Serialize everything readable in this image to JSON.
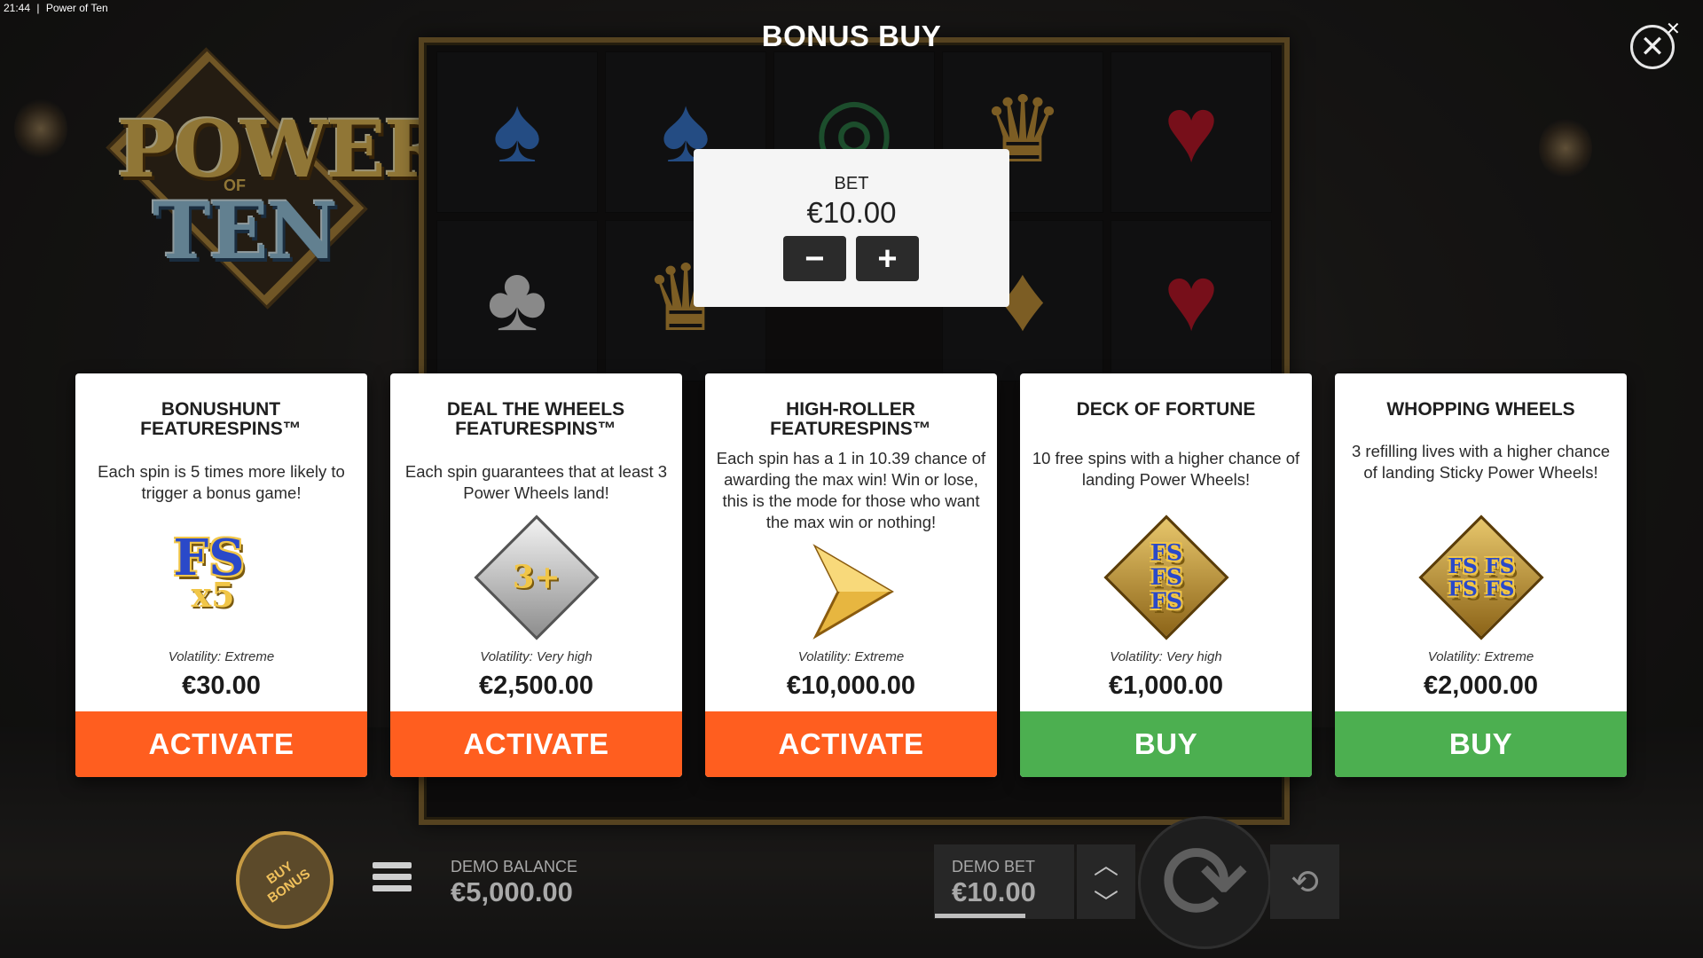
{
  "status_bar": {
    "time": "21:44",
    "app": "Power of Ten"
  },
  "title": "BONUS BUY",
  "close_icon": "close-icon",
  "logo": {
    "line1": "POWER",
    "line2": "OF",
    "line3": "TEN"
  },
  "bet": {
    "label": "BET",
    "value": "€10.00",
    "minus": "−",
    "plus": "+"
  },
  "cards": [
    {
      "title": "BONUSHUNT FEATURESPINS™",
      "description": "Each spin is 5 times more likely to trigger a bonus game!",
      "icon": "fs-x5-icon",
      "icon_text": "FS",
      "icon_sub": "x5",
      "volatility": "Volatility: Extreme",
      "price": "€30.00",
      "button": "ACTIVATE",
      "button_color": "#ff5e1f"
    },
    {
      "title": "DEAL THE WHEELS FEATURESPINS™",
      "description": "Each spin guarantees that at least 3 Power Wheels land!",
      "icon": "power-wheels-3-icon",
      "icon_text": "3+",
      "volatility": "Volatility: Very high",
      "price": "€2,500.00",
      "button": "ACTIVATE",
      "button_color": "#ff5e1f"
    },
    {
      "title": "HIGH-ROLLER FEATURESPINS™",
      "description": "Each spin has a 1 in 10.39 chance of awarding the max win! Win or lose, this is the mode for those who want the max win or nothing!",
      "icon": "gold-arrow-icon",
      "volatility": "Volatility: Extreme",
      "price": "€10,000.00",
      "button": "ACTIVATE",
      "button_color": "#ff5e1f"
    },
    {
      "title": "DECK OF FORTUNE",
      "description": "10 free spins with a higher chance of landing Power Wheels!",
      "icon": "fs-triple-icon",
      "icon_text": "FS FS FS",
      "volatility": "Volatility: Very high",
      "price": "€1,000.00",
      "button": "BUY",
      "button_color": "#4caf50"
    },
    {
      "title": "WHOPPING WHEELS",
      "description": "3 refilling lives with a higher chance of landing Sticky Power Wheels!",
      "icon": "fs-quad-icon",
      "icon_text": "FS FS FS FS",
      "volatility": "Volatility: Extreme",
      "price": "€2,000.00",
      "button": "BUY",
      "button_color": "#4caf50"
    }
  ],
  "bottom_bar": {
    "buy_bonus": "BUY BONUS",
    "balance_label": "DEMO BALANCE",
    "balance_value": "€5,000.00",
    "bet_label": "DEMO BET",
    "bet_value": "€10.00"
  },
  "colors": {
    "activate": "#ff5e1f",
    "buy": "#4caf50",
    "frame_gold": "#8b6d35"
  }
}
